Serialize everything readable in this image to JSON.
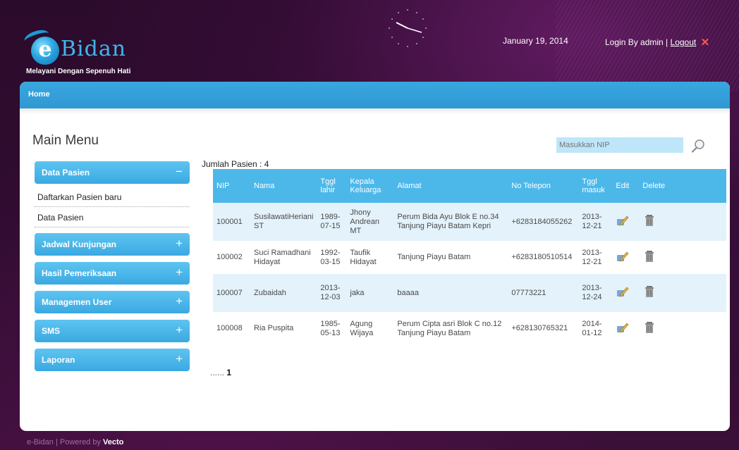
{
  "header": {
    "logo_word": "Bidan",
    "logo_letter": "e",
    "tagline": "Melayani Dengan Sepenuh Hati",
    "date": "January 19, 2014",
    "login_text": "Login By admin |",
    "logout_label": "Logout",
    "logout_icon": "✕"
  },
  "nav": {
    "home": "Home"
  },
  "menu": {
    "title": "Main Menu",
    "sections": [
      {
        "label": "Data Pasien",
        "sign": "−",
        "items": [
          "Daftarkan Pasien baru",
          "Data Pasien"
        ]
      },
      {
        "label": "Jadwal Kunjungan",
        "sign": "+"
      },
      {
        "label": "Hasil Pemeriksaan",
        "sign": "+"
      },
      {
        "label": "Managemen User",
        "sign": "+"
      },
      {
        "label": "SMS",
        "sign": "+"
      },
      {
        "label": "Laporan",
        "sign": "+"
      }
    ]
  },
  "search": {
    "placeholder": "Masukkan NIP"
  },
  "patients": {
    "count_label": "Jumlah Pasien : 4",
    "columns": [
      "NIP",
      "Nama",
      "Tggl lahir",
      "Kepala Keluarga",
      "Alamat",
      "No Telepon",
      "Tggl masuk",
      "Edit",
      "Delete"
    ],
    "rows": [
      [
        "100001",
        "SusilawatiHeriani ST",
        "1989-07-15",
        "Jhony Andrean MT",
        "Perum Bida Ayu Blok E no.34 Tanjung Piayu Batam Kepri",
        "+6283184055262",
        "2013-12-21"
      ],
      [
        "100002",
        "Suci Ramadhani Hidayat",
        "1992-03-15",
        "Taufik Hidayat",
        "Tanjung Piayu Batam",
        "+6283180510514",
        "2013-12-21"
      ],
      [
        "100007",
        "Zubaidah",
        "2013-12-03",
        "jaka",
        "baaaa",
        "07773221",
        "2013-12-24"
      ],
      [
        "100008",
        "Ria Puspita",
        "1985-05-13",
        "Agung Wijaya",
        "Perum Cipta asri Blok C no.12 Tanjung Piayu Batam",
        "+628130765321",
        "2014-01-12"
      ]
    ]
  },
  "pager": {
    "dots": "......",
    "page": "1"
  },
  "footer": {
    "text": "e-Bidan | Powered by",
    "brand": "Vecto"
  },
  "colors": {
    "accent": "#3aa9e2",
    "header_bg": "#2b0b2c",
    "row_alt": "#e3f2fb"
  }
}
